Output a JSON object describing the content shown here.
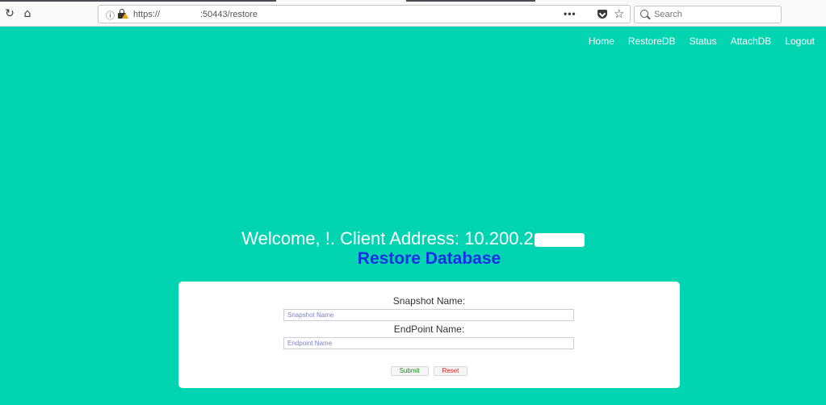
{
  "browser": {
    "url_prefix": "https://",
    "url_suffix": ":50443/restore",
    "search_placeholder": "Search",
    "more_label": "•••"
  },
  "nav": {
    "items": [
      "Home",
      "RestoreDB",
      "Status",
      "AttachDB",
      "Logout"
    ]
  },
  "header": {
    "welcome": "Welcome, !. Client Address: 10.200.2",
    "title": "Restore Database"
  },
  "form": {
    "snapshot_label": "Snapshot Name:",
    "snapshot_placeholder": "Snapshot Name",
    "endpoint_label": "EndPoint Name:",
    "endpoint_placeholder": "Endpoint Name",
    "submit_label": "Submit",
    "reset_label": "Reset"
  },
  "colors": {
    "background": "#00d4b1",
    "title": "#1a2ee6",
    "submit": "#1a8a1a",
    "reset": "#e02020"
  }
}
